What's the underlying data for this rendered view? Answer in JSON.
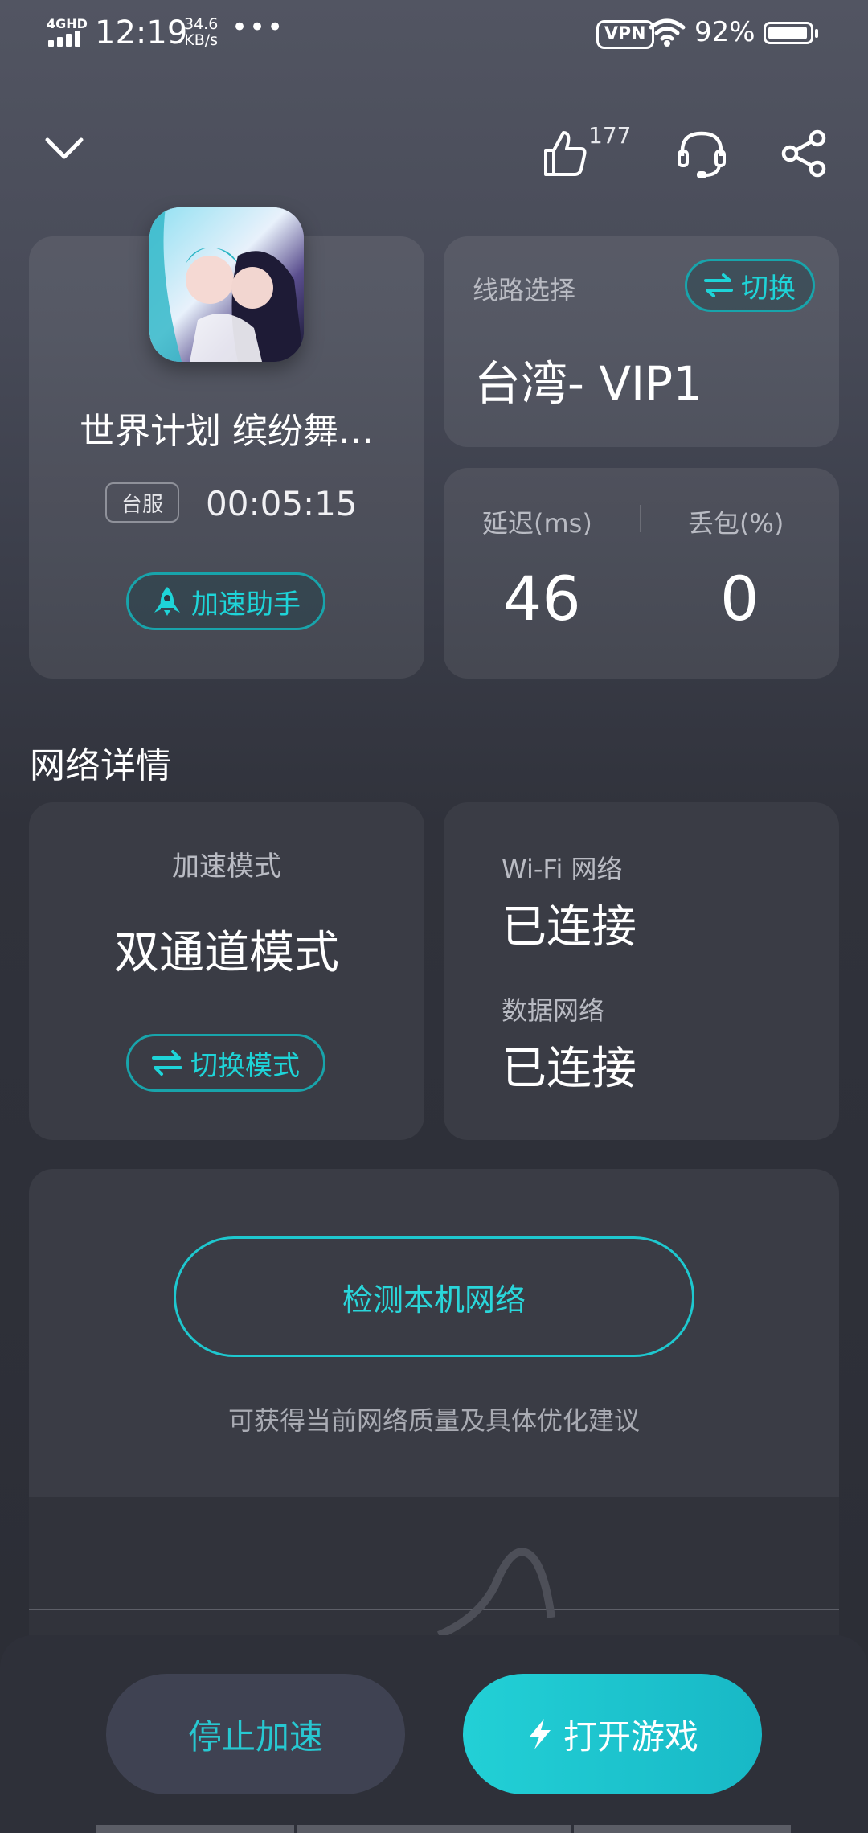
{
  "status_bar": {
    "network_type": "4GHD",
    "time": "12:19",
    "speed_value": "34.6",
    "speed_unit": "KB/s",
    "more": "•••",
    "vpn": "VPN",
    "battery_percent": "92%"
  },
  "header": {
    "like_count": "177"
  },
  "game_card": {
    "title": "世界计划 缤纷舞…",
    "server_tag": "台服",
    "elapsed_time": "00:05:15",
    "assistant_button": "加速助手"
  },
  "route_card": {
    "label": "线路选择",
    "switch_button": "切换",
    "route_name": "台湾- VIP1"
  },
  "stats_card": {
    "latency_label": "延迟(ms)",
    "latency_value": "46",
    "loss_label": "丢包(%)",
    "loss_value": "0"
  },
  "network_details": {
    "section_title": "网络详情",
    "mode_label": "加速模式",
    "mode_value": "双通道模式",
    "switch_mode_button": "切换模式",
    "wifi_label": "Wi-Fi 网络",
    "wifi_status": "已连接",
    "data_label": "数据网络",
    "data_status": "已连接"
  },
  "detect": {
    "button": "检测本机网络",
    "hint": "可获得当前网络质量及具体优化建议"
  },
  "bottom": {
    "stop_button": "停止加速",
    "open_button": "打开游戏"
  },
  "colors": {
    "accent": "#1ed4d8",
    "open_button": "#1cc6cf",
    "background": "#2b2d35"
  }
}
